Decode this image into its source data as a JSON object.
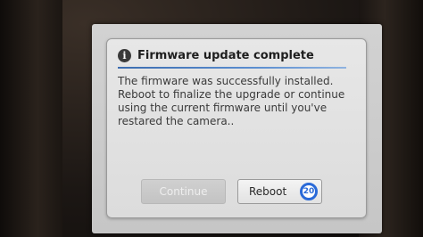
{
  "dialog": {
    "icon": "info-icon",
    "icon_glyph": "i",
    "title": "Firmware update complete",
    "message": "The firmware was successfully installed.\nReboot to finalize the upgrade or continue\nusing the current firmware until you've\nrestared the camera..",
    "accent_color": "#3c6db0"
  },
  "buttons": {
    "continue_label": "Continue",
    "continue_enabled": false,
    "reboot_label": "Reboot",
    "reboot_countdown": "20"
  }
}
